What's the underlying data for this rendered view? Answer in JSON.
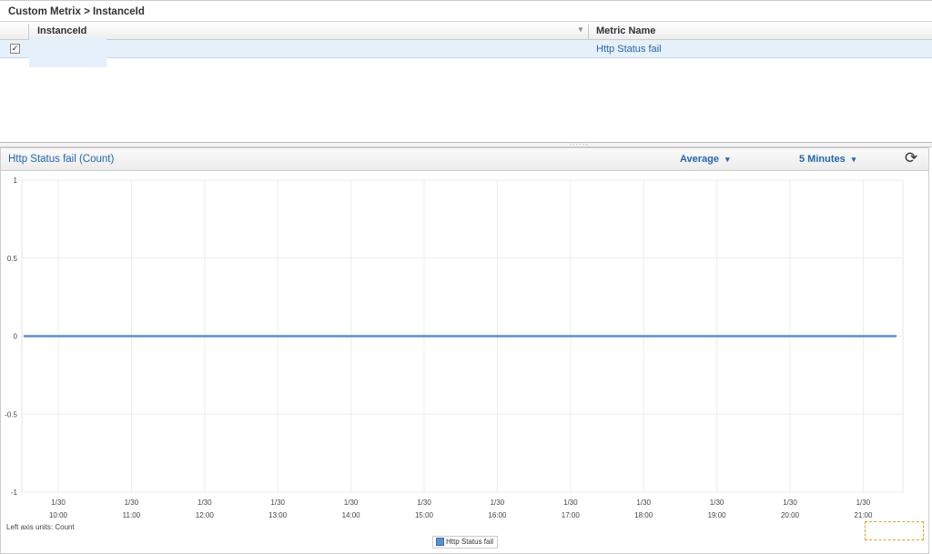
{
  "breadcrumb": "Custom Metrix > InstanceId",
  "grid": {
    "columns": [
      "InstanceId",
      "Metric Name"
    ],
    "rows": [
      {
        "checked": true,
        "check_glyph": "✓",
        "instance_id": "",
        "metric_name": "Http Status fail"
      }
    ],
    "sort_icon": "chevron-down-icon"
  },
  "chart_panel": {
    "title": "Http Status fail (Count)",
    "statistic": "Average",
    "period": "5 Minutes",
    "refresh_icon": "refresh-icon",
    "left_axis_units": "Left axis units:  Count",
    "legend_label": "Http Status fail"
  },
  "chart_data": {
    "type": "line",
    "y_ticks": [
      "1",
      "0.5",
      "0",
      "-0.5",
      "-1"
    ],
    "ylim": [
      -1,
      1
    ],
    "x_ticks": [
      {
        "date": "1/30",
        "time": "10:00"
      },
      {
        "date": "1/30",
        "time": "11:00"
      },
      {
        "date": "1/30",
        "time": "12:00"
      },
      {
        "date": "1/30",
        "time": "13:00"
      },
      {
        "date": "1/30",
        "time": "14:00"
      },
      {
        "date": "1/30",
        "time": "15:00"
      },
      {
        "date": "1/30",
        "time": "16:00"
      },
      {
        "date": "1/30",
        "time": "17:00"
      },
      {
        "date": "1/30",
        "time": "18:00"
      },
      {
        "date": "1/30",
        "time": "19:00"
      },
      {
        "date": "1/30",
        "time": "20:00"
      },
      {
        "date": "1/30",
        "time": "21:00"
      }
    ],
    "series": [
      {
        "name": "Http Status fail",
        "values": [
          0,
          0
        ],
        "color": "#5b8fcf"
      }
    ],
    "grid": true,
    "legend_position": "bottom-center"
  }
}
